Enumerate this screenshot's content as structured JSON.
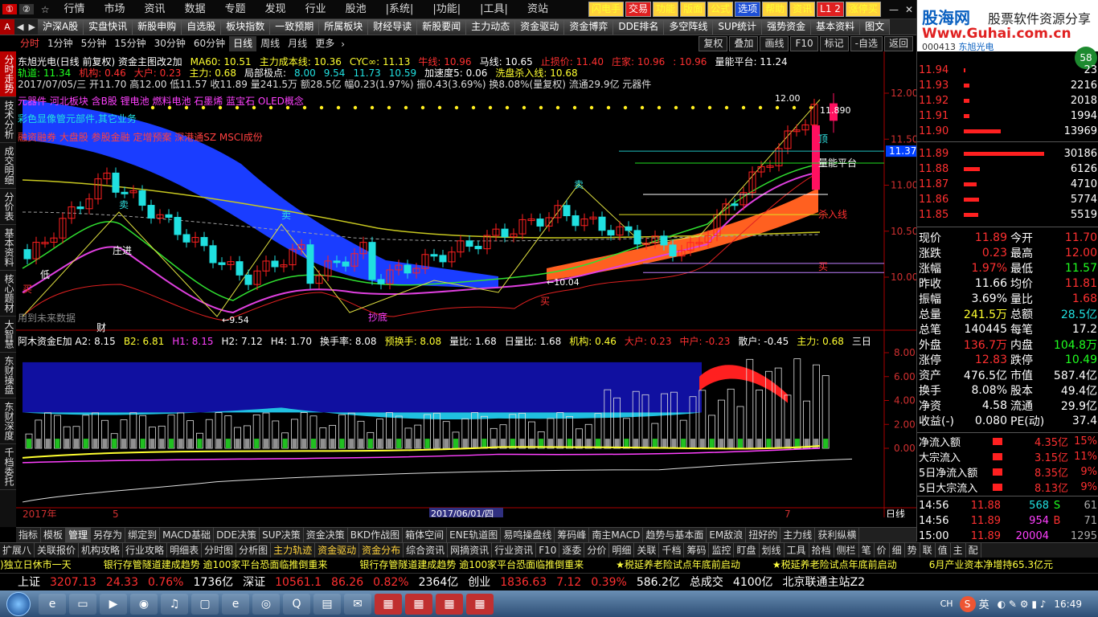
{
  "topbar": {
    "menus": [
      "行情",
      "市场",
      "资讯",
      "数据",
      "专题",
      "发现",
      "行业",
      "股池",
      "|系统|",
      "|功能|",
      "|工具|",
      "资站"
    ],
    "quick_buttons": [
      {
        "label": "闪电手",
        "style": "yellow"
      },
      {
        "label": "交易",
        "style": "red"
      },
      {
        "label": "功能",
        "style": "yellow"
      },
      {
        "label": "版面",
        "style": "yellow"
      },
      {
        "label": "公式",
        "style": "yellow"
      },
      {
        "label": "选项",
        "style": "blue"
      },
      {
        "label": "帮助",
        "style": "yellow"
      },
      {
        "label": "资讯",
        "style": "yellow"
      },
      {
        "label": "L1 2",
        "style": "red"
      },
      {
        "label": "涨停买",
        "style": "yellow"
      }
    ]
  },
  "tabbar": {
    "tabs": [
      "沪深A股",
      "实盘快讯",
      "新股申购",
      "自选股",
      "板块指数",
      "一致预期",
      "所属板块",
      "财经导读",
      "新股要闻",
      "主力动态",
      "资金驱动",
      "资金博弈",
      "DDE排名",
      "多空阵线",
      "SUP统计",
      "强势资金",
      "基本资料",
      "图文"
    ]
  },
  "periodbar": {
    "periods": [
      "分时",
      "1分钟",
      "5分钟",
      "15分钟",
      "30分钟",
      "60分钟",
      "日线",
      "周线",
      "月线",
      "更多"
    ],
    "active": "日线",
    "right_buttons": [
      "复权",
      "叠加",
      "画线",
      "F10",
      "标记",
      "-自选",
      "返回"
    ]
  },
  "sidetabs": [
    "分时走势",
    "技术分析",
    "成交明细",
    "分价表",
    "基本资料",
    "核心题材",
    "大智慧",
    "东财操盘",
    "东财深度",
    "千档委托"
  ],
  "chart": {
    "info1": [
      {
        "t": "东旭光电(日线 前复权) 资金主图改2加",
        "c": "white"
      },
      {
        "t": "MA60: 10.51",
        "c": "yellow"
      },
      {
        "t": "主力成本线: 10.36",
        "c": "yellow"
      },
      {
        "t": "CYC∞: 11.13",
        "c": "yellow"
      },
      {
        "t": "牛线: 10.96",
        "c": "red"
      },
      {
        "t": "马线: 10.65",
        "c": "white"
      },
      {
        "t": "止损价: 11.40",
        "c": "red"
      },
      {
        "t": "庄家: 10.96",
        "c": "red"
      },
      {
        "t": ": 10.96",
        "c": "red"
      },
      {
        "t": "量能平台: 11.24",
        "c": "white"
      }
    ],
    "info2": [
      {
        "t": "轨道: 11.34",
        "c": "green"
      },
      {
        "t": "机构: 0.46",
        "c": "red"
      },
      {
        "t": "大户: 0.23",
        "c": "red"
      },
      {
        "t": "主力: 0.68",
        "c": "yellow"
      },
      {
        "t": "局部极点:",
        "c": "white"
      },
      {
        "t": "8.00",
        "c": "cyan"
      },
      {
        "t": "9.54",
        "c": "cyan"
      },
      {
        "t": "11.73",
        "c": "cyan"
      },
      {
        "t": "10.59",
        "c": "cyan"
      },
      {
        "t": "加速度5: 0.06",
        "c": "white"
      },
      {
        "t": "洗盘杀入线: 10.68",
        "c": "yellow"
      }
    ],
    "info3": "2017/07/05/三 开11.70 高12.00 低11.57 收11.89 量241.5万 额28.5亿 幅0.23(1.97%) 振0.43(3.69%) 换8.08%(量复权) 流通29.9亿 元器件",
    "concepts1": "元器件 河北板块 含B股 锂电池 燃料电池 石墨烯 蓝宝石 OLED概念",
    "concepts2": "彩色显像管元部件,其它业务",
    "concepts3": "融资融券 大盘股 参股金融 定增预案 深港通SZ MSCI成份",
    "labels": {
      "sell": "卖",
      "buy": "买",
      "zhuangjin": "庄进",
      "low_label": "低",
      "sell_off": "抄底",
      "future": "用到未来数据",
      "finance": "财",
      "top": "顶",
      "liang_neng": "量能平台",
      "sharu": "杀入线",
      "low_value": "9.54",
      "low_value2": "10.04",
      "high_value": "12.00",
      "right_val": "11.890"
    },
    "y_axis": [
      "12.00",
      "11.50",
      "11.00",
      "10.50",
      "10.00"
    ],
    "price_tag": "11.37",
    "sub_info": [
      {
        "t": "阿木资金E加 A2: 8.15",
        "c": "white"
      },
      {
        "t": "B2: 6.81",
        "c": "yellow"
      },
      {
        "t": "H1: 8.15",
        "c": "magenta"
      },
      {
        "t": "H2: 7.12",
        "c": "white"
      },
      {
        "t": "H4: 1.70",
        "c": "white"
      },
      {
        "t": "换手率: 8.08",
        "c": "white"
      },
      {
        "t": "预换手: 8.08",
        "c": "yellow"
      },
      {
        "t": "量比: 1.68",
        "c": "white"
      },
      {
        "t": "日量比: 1.68",
        "c": "white"
      },
      {
        "t": "机构: 0.46",
        "c": "yellow"
      },
      {
        "t": "大户: 0.23",
        "c": "red"
      },
      {
        "t": "中户: -0.23",
        "c": "red"
      },
      {
        "t": "散户: -0.45",
        "c": "white"
      },
      {
        "t": "主力: 0.68",
        "c": "yellow"
      },
      {
        "t": "三日",
        "c": "white"
      }
    ],
    "sub_y_axis": [
      "8.00",
      "6.00",
      "4.00",
      "2.00",
      "0.00"
    ],
    "x_axis": {
      "start": "2017年",
      "m5": "5",
      "cursor_date": "2017/06/01/四",
      "m7": "7",
      "period": "日线"
    }
  },
  "orderbook": {
    "asks": [
      {
        "p": "11.94",
        "v": "23"
      },
      {
        "p": "11.93",
        "v": "2216"
      },
      {
        "p": "11.92",
        "v": "2018"
      },
      {
        "p": "11.91",
        "v": "1994"
      },
      {
        "p": "11.90",
        "v": "13969"
      }
    ],
    "bids": [
      {
        "p": "11.89",
        "v": "30186"
      },
      {
        "p": "11.88",
        "v": "6126"
      },
      {
        "p": "11.87",
        "v": "4710"
      },
      {
        "p": "11.86",
        "v": "5774"
      },
      {
        "p": "11.85",
        "v": "5519"
      }
    ]
  },
  "quote": [
    {
      "l": "现价",
      "v": "11.89",
      "vc": "red",
      "l2": "今开",
      "v2": "11.70",
      "v2c": "red"
    },
    {
      "l": "涨跌",
      "v": "0.23",
      "vc": "red",
      "l2": "最高",
      "v2": "12.00",
      "v2c": "red"
    },
    {
      "l": "涨幅",
      "v": "1.97%",
      "vc": "red",
      "l2": "最低",
      "v2": "11.57",
      "v2c": "green"
    },
    {
      "l": "昨收",
      "v": "11.66",
      "vc": "white",
      "l2": "均价",
      "v2": "11.81",
      "v2c": "red"
    },
    {
      "l": "振幅",
      "v": "3.69%",
      "vc": "white",
      "l2": "量比",
      "v2": "1.68",
      "v2c": "red"
    },
    {
      "l": "总量",
      "v": "241.5万",
      "vc": "yellow",
      "l2": "总额",
      "v2": "28.5亿",
      "v2c": "cyan"
    },
    {
      "l": "总笔",
      "v": "140445",
      "vc": "white",
      "l2": "每笔",
      "v2": "17.2",
      "v2c": "white"
    },
    {
      "l": "外盘",
      "v": "136.7万",
      "vc": "red",
      "l2": "内盘",
      "v2": "104.8万",
      "v2c": "green"
    },
    {
      "l": "涨停",
      "v": "12.83",
      "vc": "red",
      "l2": "跌停",
      "v2": "10.49",
      "v2c": "green"
    },
    {
      "l": "资产",
      "v": "476.5亿",
      "vc": "white",
      "l2": "市值",
      "v2": "587.4亿",
      "v2c": "white"
    },
    {
      "l": "换手",
      "v": "8.08%",
      "vc": "white",
      "l2": "股本",
      "v2": "49.4亿",
      "v2c": "white"
    },
    {
      "l": "净资",
      "v": "4.58",
      "vc": "white",
      "l2": "流通",
      "v2": "29.9亿",
      "v2c": "white"
    },
    {
      "l": "收益(-)",
      "v": "0.080",
      "vc": "white",
      "l2": "PE(动)",
      "v2": "37.4",
      "v2c": "white"
    }
  ],
  "flows": [
    {
      "l": "净流入额",
      "v": "4.35亿",
      "p": "15%"
    },
    {
      "l": "大宗流入",
      "v": "3.15亿",
      "p": "11%"
    },
    {
      "l": "5日净流入额",
      "v": "8.35亿",
      "p": "9%"
    },
    {
      "l": "5日大宗流入",
      "v": "8.13亿",
      "p": "9%"
    }
  ],
  "ticks": [
    {
      "t": "14:56",
      "p": "11.88",
      "v": "568",
      "d": "S",
      "n": "61"
    },
    {
      "t": "14:56",
      "p": "11.89",
      "v": "954",
      "d": "B",
      "n": "71"
    },
    {
      "t": "15:00",
      "p": "11.89",
      "v": "20004",
      "d": "",
      "n": "1295"
    }
  ],
  "watermark": {
    "logo": "股海网",
    "slogan": "股票软件资源分享",
    "url": "Www.Guhai.com.cn",
    "stock": "东旭光电",
    "code": "000413",
    "badge": "58"
  },
  "subtabs": [
    "指标",
    "模板",
    "管理",
    "另存为",
    "绑定到",
    "MACD基础",
    "DDE决策",
    "SUP决策",
    "资金决策",
    "BKD作战图",
    "箱体空间",
    "ENE轨道图",
    "易鸣操盘线",
    "筹码峰",
    "南主MACD",
    "趋势与基本面",
    "EM敌浪",
    "扭好的",
    "主力线",
    "获利纵横"
  ],
  "funcbar": [
    "扩展八",
    "关联报价",
    "机构攻略",
    "行业攻略",
    "明细表",
    "分时图",
    "分析图",
    "主力轨迹",
    "资金驱动",
    "资金分布",
    "综合资讯",
    "网摘资讯",
    "行业资讯",
    "F10",
    "逐委",
    "分价",
    "明细",
    "关联",
    "千档",
    "筹码",
    "监控",
    "盯盘",
    "划线",
    "工具",
    "拾档",
    "侧栏",
    "笔",
    "价",
    "细",
    "势",
    "联",
    "值",
    "主",
    "配"
  ],
  "news": [
    ")独立日休市一天",
    "银行存管隧道建成趋势  逾100家平台恐面临推倒重来",
    "银行存管隧道建成趋势  逾100家平台恐面临推倒重来",
    "★税延养老险试点年底前启动",
    "★税延养老险试点年底前启动",
    "6月产业资本净增持65.3亿元"
  ],
  "indexbar": [
    {
      "t": "上证",
      "c": "white"
    },
    {
      "t": "3207.13",
      "c": "red"
    },
    {
      "t": "24.33",
      "c": "red"
    },
    {
      "t": "0.76%",
      "c": "red"
    },
    {
      "t": "1736亿",
      "c": "white"
    },
    {
      "t": "深证",
      "c": "white"
    },
    {
      "t": "10561.1",
      "c": "red"
    },
    {
      "t": "86.26",
      "c": "red"
    },
    {
      "t": "0.82%",
      "c": "red"
    },
    {
      "t": "2364亿",
      "c": "white"
    },
    {
      "t": "创业",
      "c": "white"
    },
    {
      "t": "1836.63",
      "c": "red"
    },
    {
      "t": "7.12",
      "c": "red"
    },
    {
      "t": "0.39%",
      "c": "red"
    },
    {
      "t": "586.2亿",
      "c": "white"
    },
    {
      "t": "总成交",
      "c": "white"
    },
    {
      "t": "4100亿",
      "c": "white"
    },
    {
      "t": "北京联通主站Z2",
      "c": "white"
    }
  ],
  "taskbar": {
    "time": "16:49",
    "lang": "CH",
    "ime": "英"
  }
}
